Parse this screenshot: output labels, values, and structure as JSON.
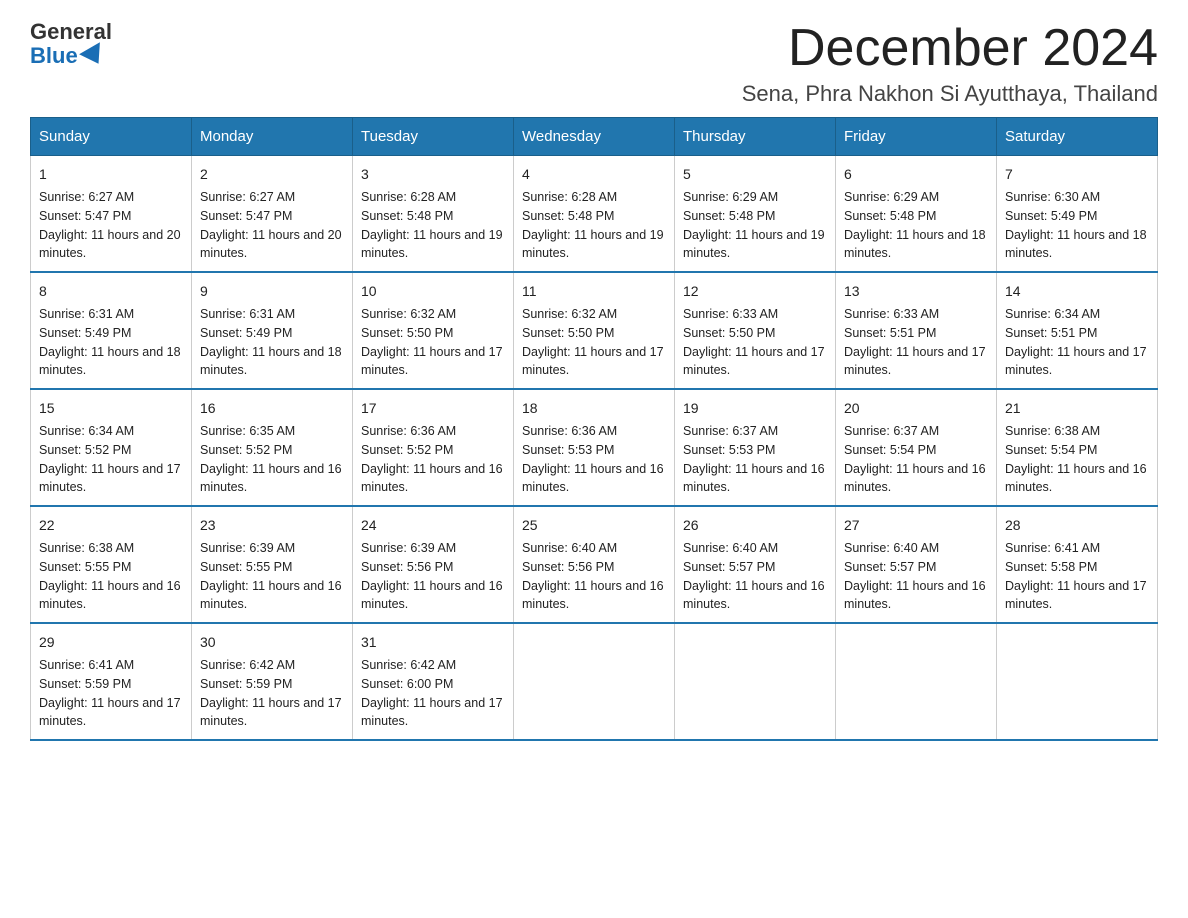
{
  "logo": {
    "general": "General",
    "blue": "Blue"
  },
  "title": "December 2024",
  "subtitle": "Sena, Phra Nakhon Si Ayutthaya, Thailand",
  "days_header": [
    "Sunday",
    "Monday",
    "Tuesday",
    "Wednesday",
    "Thursday",
    "Friday",
    "Saturday"
  ],
  "weeks": [
    [
      {
        "day": "1",
        "sunrise": "6:27 AM",
        "sunset": "5:47 PM",
        "daylight": "11 hours and 20 minutes."
      },
      {
        "day": "2",
        "sunrise": "6:27 AM",
        "sunset": "5:47 PM",
        "daylight": "11 hours and 20 minutes."
      },
      {
        "day": "3",
        "sunrise": "6:28 AM",
        "sunset": "5:48 PM",
        "daylight": "11 hours and 19 minutes."
      },
      {
        "day": "4",
        "sunrise": "6:28 AM",
        "sunset": "5:48 PM",
        "daylight": "11 hours and 19 minutes."
      },
      {
        "day": "5",
        "sunrise": "6:29 AM",
        "sunset": "5:48 PM",
        "daylight": "11 hours and 19 minutes."
      },
      {
        "day": "6",
        "sunrise": "6:29 AM",
        "sunset": "5:48 PM",
        "daylight": "11 hours and 18 minutes."
      },
      {
        "day": "7",
        "sunrise": "6:30 AM",
        "sunset": "5:49 PM",
        "daylight": "11 hours and 18 minutes."
      }
    ],
    [
      {
        "day": "8",
        "sunrise": "6:31 AM",
        "sunset": "5:49 PM",
        "daylight": "11 hours and 18 minutes."
      },
      {
        "day": "9",
        "sunrise": "6:31 AM",
        "sunset": "5:49 PM",
        "daylight": "11 hours and 18 minutes."
      },
      {
        "day": "10",
        "sunrise": "6:32 AM",
        "sunset": "5:50 PM",
        "daylight": "11 hours and 17 minutes."
      },
      {
        "day": "11",
        "sunrise": "6:32 AM",
        "sunset": "5:50 PM",
        "daylight": "11 hours and 17 minutes."
      },
      {
        "day": "12",
        "sunrise": "6:33 AM",
        "sunset": "5:50 PM",
        "daylight": "11 hours and 17 minutes."
      },
      {
        "day": "13",
        "sunrise": "6:33 AM",
        "sunset": "5:51 PM",
        "daylight": "11 hours and 17 minutes."
      },
      {
        "day": "14",
        "sunrise": "6:34 AM",
        "sunset": "5:51 PM",
        "daylight": "11 hours and 17 minutes."
      }
    ],
    [
      {
        "day": "15",
        "sunrise": "6:34 AM",
        "sunset": "5:52 PM",
        "daylight": "11 hours and 17 minutes."
      },
      {
        "day": "16",
        "sunrise": "6:35 AM",
        "sunset": "5:52 PM",
        "daylight": "11 hours and 16 minutes."
      },
      {
        "day": "17",
        "sunrise": "6:36 AM",
        "sunset": "5:52 PM",
        "daylight": "11 hours and 16 minutes."
      },
      {
        "day": "18",
        "sunrise": "6:36 AM",
        "sunset": "5:53 PM",
        "daylight": "11 hours and 16 minutes."
      },
      {
        "day": "19",
        "sunrise": "6:37 AM",
        "sunset": "5:53 PM",
        "daylight": "11 hours and 16 minutes."
      },
      {
        "day": "20",
        "sunrise": "6:37 AM",
        "sunset": "5:54 PM",
        "daylight": "11 hours and 16 minutes."
      },
      {
        "day": "21",
        "sunrise": "6:38 AM",
        "sunset": "5:54 PM",
        "daylight": "11 hours and 16 minutes."
      }
    ],
    [
      {
        "day": "22",
        "sunrise": "6:38 AM",
        "sunset": "5:55 PM",
        "daylight": "11 hours and 16 minutes."
      },
      {
        "day": "23",
        "sunrise": "6:39 AM",
        "sunset": "5:55 PM",
        "daylight": "11 hours and 16 minutes."
      },
      {
        "day": "24",
        "sunrise": "6:39 AM",
        "sunset": "5:56 PM",
        "daylight": "11 hours and 16 minutes."
      },
      {
        "day": "25",
        "sunrise": "6:40 AM",
        "sunset": "5:56 PM",
        "daylight": "11 hours and 16 minutes."
      },
      {
        "day": "26",
        "sunrise": "6:40 AM",
        "sunset": "5:57 PM",
        "daylight": "11 hours and 16 minutes."
      },
      {
        "day": "27",
        "sunrise": "6:40 AM",
        "sunset": "5:57 PM",
        "daylight": "11 hours and 16 minutes."
      },
      {
        "day": "28",
        "sunrise": "6:41 AM",
        "sunset": "5:58 PM",
        "daylight": "11 hours and 17 minutes."
      }
    ],
    [
      {
        "day": "29",
        "sunrise": "6:41 AM",
        "sunset": "5:59 PM",
        "daylight": "11 hours and 17 minutes."
      },
      {
        "day": "30",
        "sunrise": "6:42 AM",
        "sunset": "5:59 PM",
        "daylight": "11 hours and 17 minutes."
      },
      {
        "day": "31",
        "sunrise": "6:42 AM",
        "sunset": "6:00 PM",
        "daylight": "11 hours and 17 minutes."
      },
      null,
      null,
      null,
      null
    ]
  ]
}
